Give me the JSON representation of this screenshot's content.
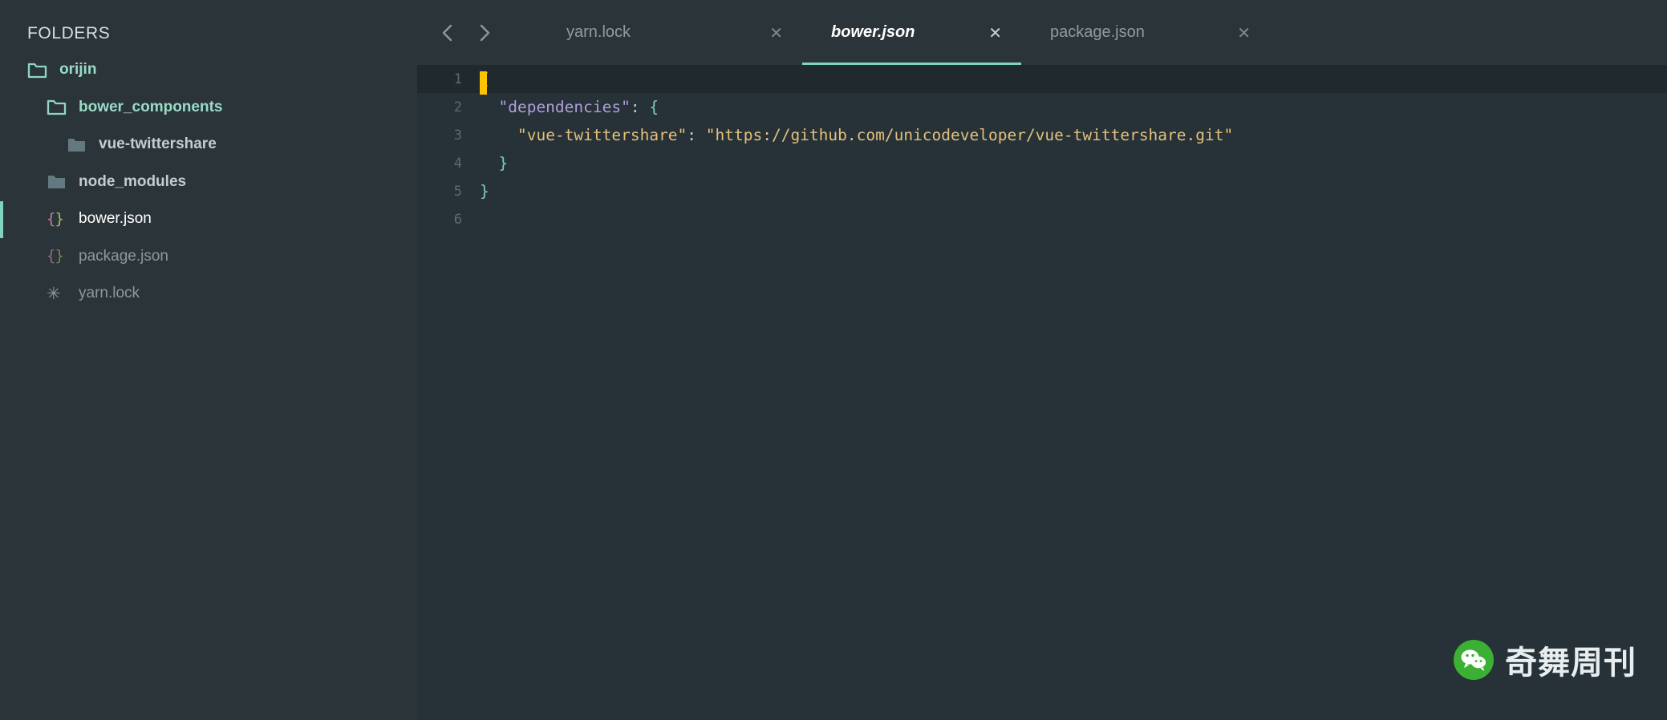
{
  "sidebar": {
    "title": "FOLDERS",
    "items": [
      {
        "label": "orijin",
        "icon": "folder-open-icon",
        "level": 0,
        "state": "open-folder"
      },
      {
        "label": "bower_components",
        "icon": "folder-open-icon",
        "level": 1,
        "state": "open-folder"
      },
      {
        "label": "vue-twittershare",
        "icon": "folder-closed-icon",
        "level": 2,
        "state": "closed-folder"
      },
      {
        "label": "node_modules",
        "icon": "folder-closed-icon",
        "level": 1,
        "state": "closed-folder"
      },
      {
        "label": "bower.json",
        "icon": "json-file-icon",
        "level": 1,
        "state": "file-active"
      },
      {
        "label": "package.json",
        "icon": "json-file-icon",
        "level": 1,
        "state": "file-dim"
      },
      {
        "label": "yarn.lock",
        "icon": "lock-file-icon",
        "level": 1,
        "state": "file-dim"
      }
    ],
    "json_icon_glyph_left": "{",
    "json_icon_glyph_right": "}",
    "lock_icon_glyph": "✳",
    "accent_color": "#7fd4c1"
  },
  "tabbar": {
    "nav_back_icon": "chevron-left-icon",
    "nav_forward_icon": "chevron-right-icon",
    "nav_back_glyph": "❮",
    "nav_forward_glyph": "❯",
    "close_glyph": "✕",
    "active_underline_color": "#7fd4c1",
    "tabs": [
      {
        "label": "yarn.lock",
        "active": false
      },
      {
        "label": "bower.json",
        "active": true
      },
      {
        "label": "package.json",
        "active": false
      }
    ]
  },
  "editor": {
    "background": "#263238",
    "cursor_color": "#ffc400",
    "line_numbers": [
      "1",
      "2",
      "3",
      "4",
      "5",
      "6"
    ],
    "lines": [
      {
        "number": "1",
        "highlighted": true,
        "cursor": true,
        "tokens": [
          {
            "t": "{",
            "c": "punct"
          }
        ]
      },
      {
        "number": "2",
        "highlighted": false,
        "cursor": false,
        "tokens": [
          {
            "t": "  ",
            "c": "plain"
          },
          {
            "t": "\"dependencies\"",
            "c": "key"
          },
          {
            "t": ": ",
            "c": "colon"
          },
          {
            "t": "{",
            "c": "punct"
          }
        ]
      },
      {
        "number": "3",
        "highlighted": false,
        "cursor": false,
        "tokens": [
          {
            "t": "    ",
            "c": "plain"
          },
          {
            "t": "\"vue-twittershare\"",
            "c": "str"
          },
          {
            "t": ": ",
            "c": "colon"
          },
          {
            "t": "\"https://github.com/unicodeveloper/vue-twittershare.git\"",
            "c": "str"
          }
        ]
      },
      {
        "number": "4",
        "highlighted": false,
        "cursor": false,
        "tokens": [
          {
            "t": "  ",
            "c": "plain"
          },
          {
            "t": "}",
            "c": "punct"
          }
        ]
      },
      {
        "number": "5",
        "highlighted": false,
        "cursor": false,
        "tokens": [
          {
            "t": "}",
            "c": "punct"
          }
        ]
      },
      {
        "number": "6",
        "highlighted": false,
        "cursor": false,
        "tokens": []
      }
    ]
  },
  "watermark": {
    "text": "奇舞周刊",
    "logo_icon": "wechat-icon",
    "logo_color": "#3cb034"
  }
}
